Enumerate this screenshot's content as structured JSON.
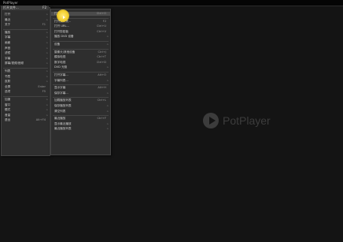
{
  "window": {
    "title": "PotPlayer"
  },
  "logo": {
    "text": "PotPlayer"
  },
  "menu1": {
    "header": {
      "label": "打开文件...",
      "shortcut": "F2"
    },
    "items": [
      {
        "label": "打开",
        "shortcut": ">"
      },
      {
        "label": "最近",
        "shortcut": ">"
      },
      {
        "label": "关于",
        "shortcut": "F1"
      },
      {
        "sep": true
      },
      {
        "label": "播放",
        "shortcut": ">"
      },
      {
        "label": "字幕",
        "shortcut": ">"
      },
      {
        "label": "画面",
        "shortcut": ">"
      },
      {
        "label": "声音",
        "shortcut": ">"
      },
      {
        "label": "滤镜",
        "shortcut": ">"
      },
      {
        "label": "字幕",
        "shortcut": ">"
      },
      {
        "label": "屏幕/视频/音频",
        "shortcut": ">"
      },
      {
        "sep": true
      },
      {
        "label": "列表",
        "shortcut": ">"
      },
      {
        "label": "书签",
        "shortcut": ">"
      },
      {
        "label": "皮肤",
        "shortcut": ">"
      },
      {
        "label": "全屏",
        "shortcut": "Enter"
      },
      {
        "label": "选项",
        "shortcut": "F5"
      },
      {
        "sep": true
      },
      {
        "label": "加速",
        "shortcut": ">"
      },
      {
        "label": "窗口",
        "shortcut": ">"
      },
      {
        "label": "模式",
        "shortcut": ">"
      },
      {
        "label": "音量",
        "shortcut": ">"
      },
      {
        "label": "退出",
        "shortcut": "Alt+F4"
      }
    ]
  },
  "menu2": {
    "items": [
      {
        "label": "打开文件...",
        "shortcut": "Ctrl+O",
        "hl": true
      },
      {
        "sep": true
      },
      {
        "label": "打开文件夹...",
        "shortcut": "F2"
      },
      {
        "label": "打开 URL...",
        "shortcut": "Ctrl+U"
      },
      {
        "label": "打开剪贴板",
        "shortcut": "Ctrl+V"
      },
      {
        "label": "播放 DVD 设备",
        "shortcut": ">"
      },
      {
        "sep": true
      },
      {
        "label": "设备",
        "shortcut": ">"
      },
      {
        "sep": true
      },
      {
        "label": "摄像头/其他设备",
        "shortcut": "Ctrl+J"
      },
      {
        "label": "模拟电视",
        "shortcut": "Ctrl+T"
      },
      {
        "label": "数字电视",
        "shortcut": "Ctrl+D"
      },
      {
        "label": "DVD 光驱",
        "shortcut": ">"
      },
      {
        "sep": true
      },
      {
        "label": "打开字幕...",
        "shortcut": "Alt+O"
      },
      {
        "label": "字幕列表...",
        "shortcut": ">"
      },
      {
        "sep": true
      },
      {
        "label": "显示字幕",
        "shortcut": "Alt+H"
      },
      {
        "label": "保存字幕...",
        "shortcut": ">"
      },
      {
        "sep": true
      },
      {
        "label": "加载播放列表",
        "shortcut": "Ctrl+L"
      },
      {
        "label": "保存播放列表",
        "shortcut": ">"
      },
      {
        "label": "清空列表",
        "shortcut": ">"
      },
      {
        "sep": true
      },
      {
        "label": "最近播放",
        "shortcut": "Ctrl+F"
      },
      {
        "label": "显示最近播放",
        "shortcut": ">"
      },
      {
        "label": "最近播放列表",
        "shortcut": ">"
      }
    ]
  }
}
